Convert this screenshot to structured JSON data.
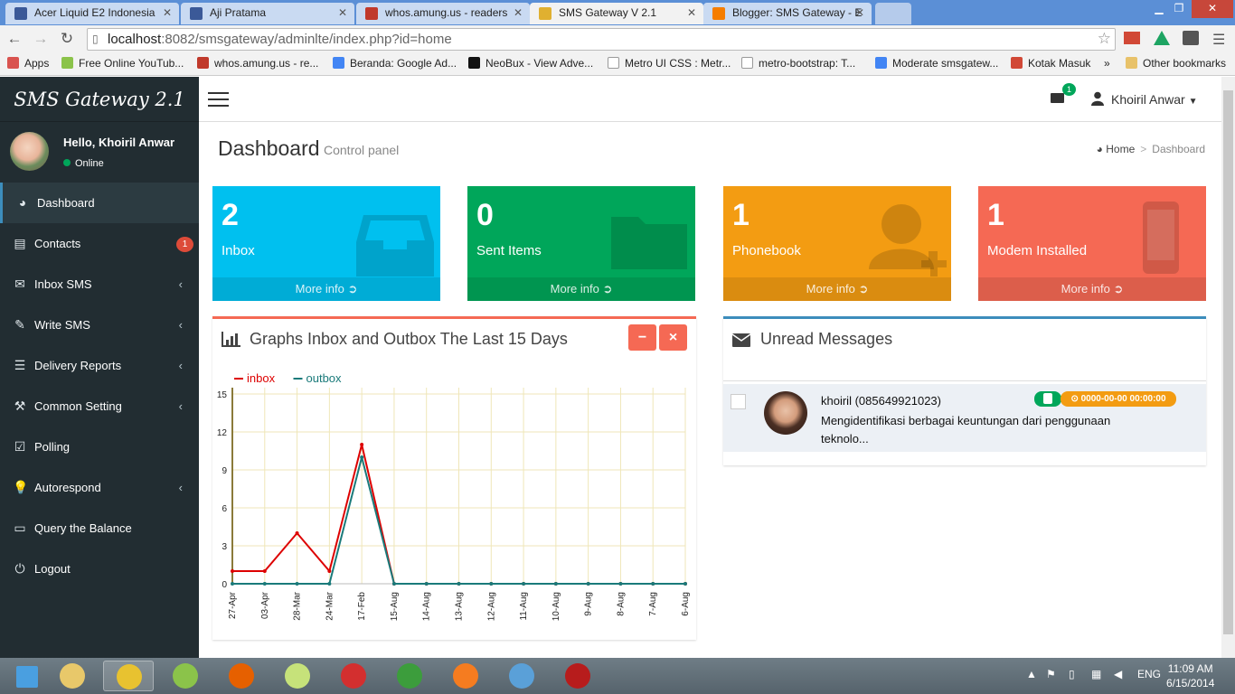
{
  "browser": {
    "tabs": [
      {
        "label": "Acer Liquid E2 Indonesia",
        "icon": "facebook-icon",
        "color": "#3b5998"
      },
      {
        "label": "Aji Pratama",
        "icon": "facebook-icon",
        "color": "#3b5998"
      },
      {
        "label": "whos.amung.us - readers",
        "icon": "whosamungus-icon",
        "color": "#c0392b"
      },
      {
        "label": "SMS Gateway V 2.1",
        "icon": "folder-icon",
        "color": "#e0b030"
      },
      {
        "label": "Blogger: SMS Gateway - E",
        "icon": "blogger-icon",
        "color": "#f57d00"
      }
    ],
    "url_host": "localhost",
    "url_rest": ":8082/smsgateway/adminlte/index.php?id=home",
    "bookmarks": [
      {
        "label": "Apps",
        "color": "#d9534f"
      },
      {
        "label": "Free Online YouTub...",
        "color": "#8bc34a"
      },
      {
        "label": "whos.amung.us - re...",
        "color": "#c0392b"
      },
      {
        "label": "Beranda: Google Ad...",
        "color": "#4285f4"
      },
      {
        "label": "NeoBux - View Adve...",
        "color": "#111"
      },
      {
        "label": "Metro UI CSS : Metr...",
        "color": "#fff"
      },
      {
        "label": "metro-bootstrap: T...",
        "color": "#fff"
      },
      {
        "label": "Moderate smsgatew...",
        "color": "#4285f4"
      },
      {
        "label": "Kotak Masuk",
        "color": "#d14836"
      },
      {
        "label": "»",
        "color": ""
      },
      {
        "label": "Other bookmarks",
        "color": "#e8c26a"
      }
    ]
  },
  "app": {
    "brand": "SMS Gateway 2.1",
    "hello": "Hello, Khoiril Anwar",
    "status": "Online",
    "menu": [
      {
        "label": "Dashboard",
        "icon": "dashboard-icon",
        "glyph": "◕",
        "active": true
      },
      {
        "label": "Contacts",
        "icon": "book-icon",
        "glyph": "▤",
        "badge": "1"
      },
      {
        "label": "Inbox SMS",
        "icon": "envelope-icon",
        "glyph": "✉",
        "chevron": true
      },
      {
        "label": "Write SMS",
        "icon": "pencil-icon",
        "glyph": "✎",
        "chevron": true
      },
      {
        "label": "Delivery Reports",
        "icon": "list-icon",
        "glyph": "☰",
        "chevron": true
      },
      {
        "label": "Common Setting",
        "icon": "wrench-icon",
        "glyph": "⚒",
        "chevron": true
      },
      {
        "label": "Polling",
        "icon": "check-square-icon",
        "glyph": "☑"
      },
      {
        "label": "Autorespond",
        "icon": "lightbulb-icon",
        "glyph": "💡",
        "chevron": true
      },
      {
        "label": "Query the Balance",
        "icon": "credit-card-icon",
        "glyph": "▭"
      },
      {
        "label": "Logout",
        "icon": "power-icon",
        "glyph": "⏻"
      }
    ],
    "header": {
      "mail_count": "1",
      "user": "Khoiril Anwar"
    },
    "page": {
      "title": "Dashboard",
      "subtitle": "Control panel",
      "crumb_home": "Home",
      "crumb_current": "Dashboard"
    },
    "stats": [
      {
        "value": "2",
        "label": "Inbox",
        "more": "More info",
        "color": "#00c0ef"
      },
      {
        "value": "0",
        "label": "Sent Items",
        "more": "More info",
        "color": "#00a65a"
      },
      {
        "value": "1",
        "label": "Phonebook",
        "more": "More info",
        "color": "#f39c12"
      },
      {
        "value": "1",
        "label": "Modem Installed",
        "more": "More info",
        "color": "#f56954"
      }
    ],
    "graph_box": {
      "title": "Graphs Inbox and Outbox The Last 15 Days",
      "minimize": "−",
      "close": "×"
    },
    "unread_box": {
      "title": "Unread Messages",
      "sender": "khoiril (085649921023)",
      "date": "⊙ 0000-00-00 00:00:00",
      "text": "Mengidentifikasi berbagai keuntungan dari penggunaan teknolo..."
    }
  },
  "chart_data": {
    "type": "line",
    "categories": [
      "27-Apr",
      "03-Apr",
      "28-Mar",
      "24-Mar",
      "17-Feb",
      "15-Aug",
      "14-Aug",
      "13-Aug",
      "12-Aug",
      "11-Aug",
      "10-Aug",
      "9-Aug",
      "8-Aug",
      "7-Aug",
      "6-Aug"
    ],
    "series": [
      {
        "name": "inbox",
        "color": "#dd0000",
        "values": [
          1,
          1,
          4,
          1,
          11,
          0,
          0,
          0,
          0,
          0,
          0,
          0,
          0,
          0,
          0
        ]
      },
      {
        "name": "outbox",
        "color": "#1a7a7a",
        "values": [
          0,
          0,
          0,
          0,
          10,
          0,
          0,
          0,
          0,
          0,
          0,
          0,
          0,
          0,
          0
        ]
      }
    ],
    "yticks": [
      0,
      3,
      6,
      9,
      12,
      15
    ],
    "ylim": [
      0,
      15.5
    ],
    "grid": true,
    "legend": "top-left"
  },
  "taskbar": {
    "apps": [
      "windows-start-icon",
      "explorer-icon",
      "chrome-icon",
      "android-icon",
      "firefox-icon",
      "sticky-notes-icon",
      "filezilla-icon",
      "idm-icon",
      "xampp-icon",
      "paint-icon",
      "acrobat-icon"
    ],
    "lang": "ENG",
    "time": "11:09 AM",
    "date": "6/15/2014"
  }
}
